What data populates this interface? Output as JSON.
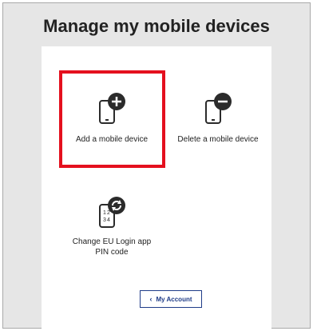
{
  "page": {
    "title": "Manage my mobile devices"
  },
  "tiles": [
    {
      "label": "Add a mobile device",
      "icon": "phone-plus-icon"
    },
    {
      "label": "Delete a mobile device",
      "icon": "phone-minus-icon"
    },
    {
      "label_line1": "Change EU Login app",
      "label_line2": "PIN code",
      "icon": "phone-pin-refresh-icon",
      "icon_text": "1 2 3 4"
    }
  ],
  "account_button": {
    "label": "My Account",
    "icon": "chevron-left-icon"
  },
  "colors": {
    "highlight": "#e4101e",
    "button": "#1f3c88",
    "icon": "#2b2b2b"
  }
}
